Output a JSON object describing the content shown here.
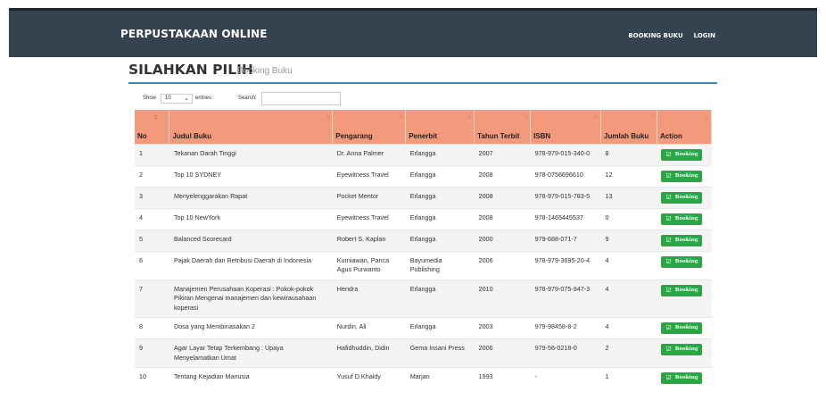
{
  "navbar": {
    "brand": "PERPUSTAKAAN ONLINE",
    "links": [
      "BOOKING BUKU",
      "LOGIN"
    ]
  },
  "header": {
    "title": "SILAHKAN PILIH",
    "subtitle": "Booking Buku"
  },
  "controls": {
    "show_label": "Show",
    "length_value": "10",
    "entries_label": "entries",
    "search_label": "Search:",
    "search_value": ""
  },
  "table": {
    "columns": [
      "No",
      "Judul Buku",
      "Pengarang",
      "Penerbit",
      "Tahun Terbit",
      "ISBN",
      "Jumlah Buku",
      "Action"
    ],
    "action_label": "Booking",
    "rows": [
      {
        "no": "1",
        "judul": "Tekanan Darah Tinggi",
        "pengarang": "Dr. Anna Palmer",
        "penerbit": "Erlangga",
        "tahun": "2007",
        "isbn": "978-979-015-340-0",
        "jumlah": "8"
      },
      {
        "no": "2",
        "judul": "Top 10 SYDNEY",
        "pengarang": "Eyewitness Travel",
        "penerbit": "Erlangga",
        "tahun": "2008",
        "isbn": "978-0756696610",
        "jumlah": "12"
      },
      {
        "no": "3",
        "judul": "Menyelenggarakan Rapat",
        "pengarang": "Pocket Mentor",
        "penerbit": "Erlangga",
        "tahun": "2008",
        "isbn": "978-979-015-783-5",
        "jumlah": "13"
      },
      {
        "no": "4",
        "judul": "Top 10 NewYork",
        "pengarang": "Eyewitness Travel",
        "penerbit": "Erlangga",
        "tahun": "2008",
        "isbn": "978-1465445537",
        "jumlah": "0"
      },
      {
        "no": "5",
        "judul": "Balanced Scorecard",
        "pengarang": "Robert S. Kaplan",
        "penerbit": "Erlangga",
        "tahun": "2000",
        "isbn": "979-688-071-7",
        "jumlah": "9"
      },
      {
        "no": "6",
        "judul": "Pajak Daerah dan Retribusi Daerah di Indonesia",
        "pengarang": "Kurniawan, Panca Agus Purwanto",
        "penerbit": "Bayumedia Publishing",
        "tahun": "2006",
        "isbn": "978-979-3695-20-4",
        "jumlah": "4"
      },
      {
        "no": "7",
        "judul": "Manajemen Perusahaan Koperasi : Pokok-pokok Pikiran Mengenai manajemen dan kewirausahaan koperasi",
        "pengarang": "Hendra",
        "penerbit": "Erlangga",
        "tahun": "2010",
        "isbn": "978-979-075-947-3",
        "jumlah": "4"
      },
      {
        "no": "8",
        "judul": "Dosa yang Membinasakan 2",
        "pengarang": "Nurdin, Ali",
        "penerbit": "Erlangga",
        "tahun": "2003",
        "isbn": "979-98458-8-2",
        "jumlah": "4"
      },
      {
        "no": "9",
        "judul": "Agar Layar Tetap Terkembang : Upaya Menyelamatkan Umat",
        "pengarang": "Hafidhuddin, Didin",
        "penerbit": "Gema Insani Press",
        "tahun": "2006",
        "isbn": "979-56-0218-0",
        "jumlah": "2"
      },
      {
        "no": "10",
        "judul": "Tentang Kejadian Manusia",
        "pengarang": "Yusuf D.Khaldy",
        "penerbit": "Marjan",
        "tahun": "1993",
        "isbn": "-",
        "jumlah": "1"
      }
    ]
  },
  "colors": {
    "navbar_bg": "#34434f",
    "table_header_bg": "#f39a7c",
    "booking_button": "#28a745",
    "header_rule": "#3c8dbc"
  },
  "icons": {
    "booking": "edit-icon",
    "sort": "sort-icon"
  }
}
